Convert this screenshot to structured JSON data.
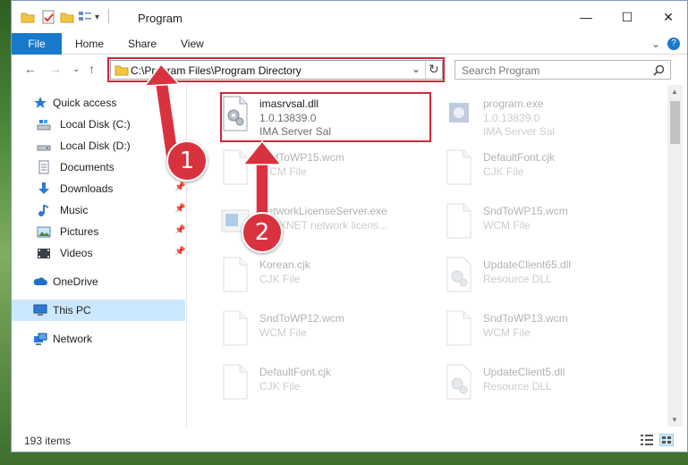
{
  "window": {
    "title": "Program",
    "minimize": "—",
    "maximize": "☐",
    "close": "✕"
  },
  "ribbon": {
    "tabs": [
      "File",
      "Home",
      "Share",
      "View"
    ],
    "collapse": "⌄",
    "help": "?"
  },
  "address": {
    "path": "C:\\Program Files\\Program Directory",
    "dropdown": "⌄",
    "refresh": "↻"
  },
  "search": {
    "placeholder": "Search Program",
    "icon": "search-icon"
  },
  "nav": {
    "back": "←",
    "forward": "→",
    "recent": "⌄",
    "up": "↑"
  },
  "sidebar": {
    "items": [
      {
        "label": "Quick access",
        "icon": "star-icon"
      },
      {
        "label": "Local Disk (C:)",
        "icon": "drive-icon",
        "pinned": false
      },
      {
        "label": "Local Disk (D:)",
        "icon": "drive-icon",
        "pinned": false
      },
      {
        "label": "Documents",
        "icon": "documents-icon",
        "pinned": false
      },
      {
        "label": "Downloads",
        "icon": "download-icon",
        "pinned": true
      },
      {
        "label": "Music",
        "icon": "music-icon",
        "pinned": true
      },
      {
        "label": "Pictures",
        "icon": "pictures-icon",
        "pinned": true
      },
      {
        "label": "Videos",
        "icon": "videos-icon",
        "pinned": true
      },
      {
        "label": "OneDrive",
        "icon": "cloud-icon"
      },
      {
        "label": "This PC",
        "icon": "computer-icon",
        "selected": true
      },
      {
        "label": "Network",
        "icon": "network-icon"
      }
    ]
  },
  "files": [
    {
      "name": "imasrvsal.dll",
      "line2": "1.0.13839.0",
      "line3": "IMA Server Sal",
      "highlighted": true
    },
    {
      "name": "program.exe",
      "line2": "1.0.13839.0",
      "line3": "IMA Server Sal"
    },
    {
      "name": "SndToWP15.wcm",
      "line2": "WCM File",
      "line3": ""
    },
    {
      "name": "DefaultFont.cjk",
      "line2": "CJK File",
      "line3": ""
    },
    {
      "name": "NetworkLicenseServer.exe",
      "line2": "FLEXNET network licens...",
      "line3": ""
    },
    {
      "name": "SndToWP15.wcm",
      "line2": "WCM File",
      "line3": ""
    },
    {
      "name": "Korean.cjk",
      "line2": "CJK File",
      "line3": ""
    },
    {
      "name": "UpdateClient65.dll",
      "line2": "Resource DLL",
      "line3": ""
    },
    {
      "name": "SndToWP12.wcm",
      "line2": "WCM File",
      "line3": ""
    },
    {
      "name": "SndToWP13.wcm",
      "line2": "WCM File",
      "line3": ""
    },
    {
      "name": "DefaultFont.cjk",
      "line2": "CJK File",
      "line3": ""
    },
    {
      "name": "UpdateClient5.dll",
      "line2": "Resource DLL",
      "line3": ""
    }
  ],
  "status": {
    "count": "193 items"
  },
  "annotations": {
    "step1": "1",
    "step2": "2",
    "color": "#d9323f"
  },
  "colors": {
    "accent": "#1979ca",
    "selection": "#cce8ff",
    "highlight": "#d6243b"
  }
}
